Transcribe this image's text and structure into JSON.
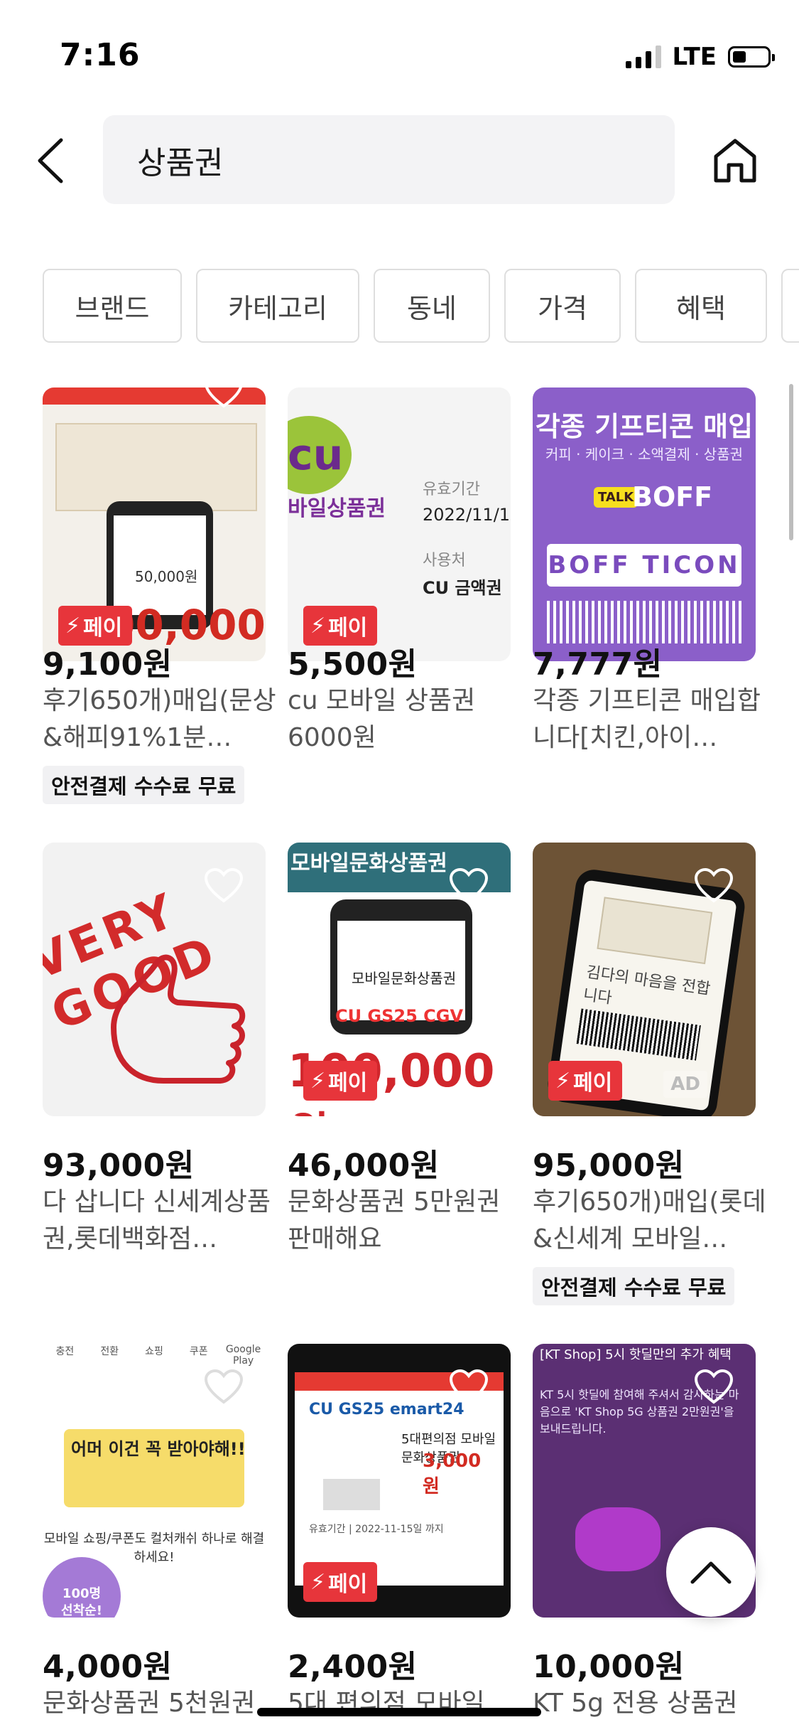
{
  "status_bar": {
    "time": "7:16",
    "network": "LTE"
  },
  "header": {
    "search_query": "상품권"
  },
  "filters": [
    "브랜드",
    "카테고리",
    "동네",
    "가격",
    "혜택"
  ],
  "products": [
    {
      "price": "9,100원",
      "title": "후기650개)매입(문상&해피91%1분…",
      "badge": "안전결제 수수료 무료",
      "pay": "페이",
      "thumb_text": "50,000원"
    },
    {
      "price": "5,500원",
      "title": "cu 모바일 상품권 6000원",
      "badge": "",
      "pay": "페이",
      "thumb_text": "CU 금액권"
    },
    {
      "price": "7,777원",
      "title": "각종 기프티콘 매입합니다[치킨,아이…",
      "badge": "",
      "pay": "",
      "thumb_text": "BOFF TICON"
    },
    {
      "price": "93,000원",
      "title": "다 삽니다 신세계상품권,롯데백화점…",
      "badge": "",
      "pay": "",
      "thumb_text": "VERY GOOD"
    },
    {
      "price": "46,000원",
      "title": "문화상품권 5만원권 판매해요",
      "badge": "",
      "pay": "페이",
      "thumb_text": "100,000원"
    },
    {
      "price": "95,000원",
      "title": "후기650개)매입(롯데&신세계 모바일…",
      "badge": "안전결제 수수료 무료",
      "pay": "페이",
      "thumb_text": "AD"
    },
    {
      "price": "4,000원",
      "title": "문화상품권 5천원권",
      "badge": "",
      "pay": "",
      "thumb_text": "어머 이건 꼭 받아야해!!"
    },
    {
      "price": "2,400원",
      "title": "5대 편의점 모바일",
      "badge": "",
      "pay": "페이",
      "thumb_text": "3,000 원"
    },
    {
      "price": "10,000원",
      "title": "KT 5g 전용 상품권",
      "badge": "",
      "pay": "",
      "thumb_text": "[KT Shop] 5시 핫딜만의 추가 혜택"
    }
  ],
  "colors": {
    "pay_badge": "#e7353b",
    "chip_border": "#dedede"
  }
}
